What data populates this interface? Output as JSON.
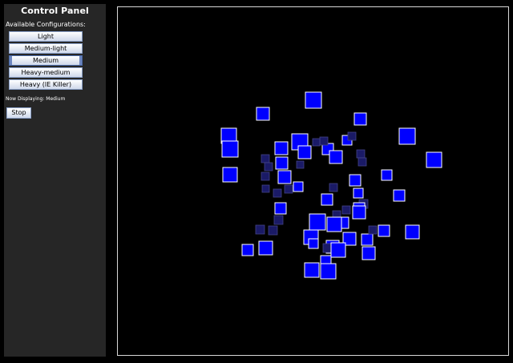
{
  "panel": {
    "title": "Control Panel",
    "subtitle": "Available Configurations:",
    "configurations": [
      "Light",
      "Medium-light",
      "Medium",
      "Heavy-medium",
      "Heavy (IE Killer)"
    ],
    "selected": "Medium",
    "now_displaying": "Now Displaying: Medium",
    "stop_label": "Stop"
  },
  "colors": {
    "panel_bg": "#262626",
    "stage_bg": "#000000",
    "stage_border": "#d8d8d8",
    "square_bright": "#0000ff",
    "square_dim": "#1a1a66",
    "square_border": "#ffffff"
  }
}
